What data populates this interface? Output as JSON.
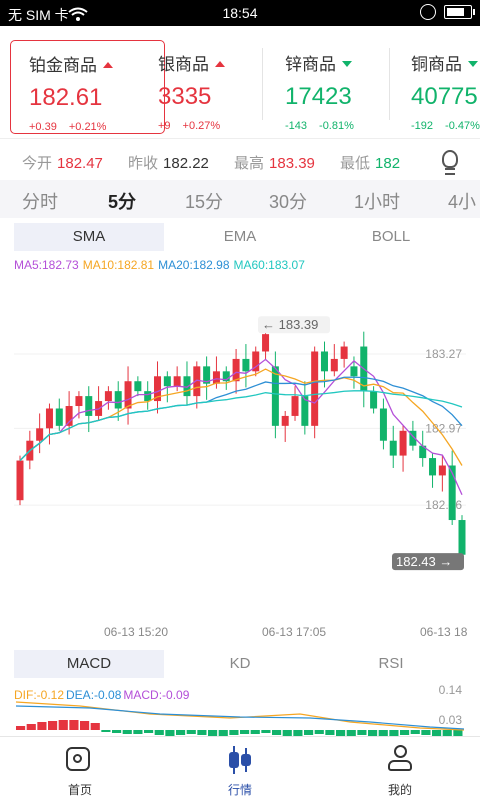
{
  "status_bar": {
    "carrier": "无 SIM 卡",
    "time": "18:54",
    "battery_level": 0.85
  },
  "products": [
    {
      "name": "铂金商品",
      "price": "182.61",
      "change": "+0.39",
      "change_pct": "+0.21%",
      "direction": "up",
      "selected": true
    },
    {
      "name": "银商品",
      "price": "3335",
      "change": "+9",
      "change_pct": "+0.27%",
      "direction": "up",
      "selected": false
    },
    {
      "name": "锌商品",
      "price": "17423",
      "change": "-143",
      "change_pct": "-0.81%",
      "direction": "down",
      "selected": false
    },
    {
      "name": "铜商品",
      "price": "40775",
      "change": "-192",
      "change_pct": "-0.47%",
      "direction": "down",
      "selected": false
    }
  ],
  "quote": {
    "open_label": "今开",
    "open": "182.47",
    "prev_close_label": "昨收",
    "prev_close": "182.22",
    "high_label": "最高",
    "high": "183.39",
    "low_label": "最低",
    "low": "182"
  },
  "periods": [
    "分时",
    "5分",
    "15分",
    "30分",
    "1小时",
    "4小"
  ],
  "active_period": "5分",
  "overlay_tabs": [
    "SMA",
    "EMA",
    "BOLL"
  ],
  "active_overlay": "SMA",
  "ma_legend": {
    "ma5": "MA5:182.73",
    "ma10": "MA10:182.81",
    "ma20": "MA20:182.98",
    "ma60": "MA60:183.07"
  },
  "indicator_tabs": [
    "MACD",
    "KD",
    "RSI"
  ],
  "active_indicator": "MACD",
  "macd_legend": {
    "dif": "DIF:-0.12",
    "dea": "DEA:-0.08",
    "macd": "MACD:-0.09"
  },
  "chart_data": {
    "type": "candlestick",
    "ylabels": [
      "183.27",
      "182.97",
      "182.66"
    ],
    "ylim": [
      182.35,
      183.52
    ],
    "max_marker": "183.39",
    "last_marker": "182.43",
    "xlabels": [
      "06-13 15:20",
      "06-13 17:05",
      "06-13 18"
    ],
    "macd_ylabels": [
      "0.14",
      "0.03"
    ],
    "colors": {
      "up": "#e5343f",
      "down": "#11b36b",
      "ma5": "#b44fd8",
      "ma10": "#f5a623",
      "ma20": "#2d8fd5",
      "ma60": "#22c7c0"
    }
  },
  "tabbar": [
    {
      "label": "首页",
      "icon": "camera-icon",
      "active": false
    },
    {
      "label": "行情",
      "icon": "candlestick-icon",
      "active": true
    },
    {
      "label": "我的",
      "icon": "user-icon",
      "active": false
    }
  ]
}
